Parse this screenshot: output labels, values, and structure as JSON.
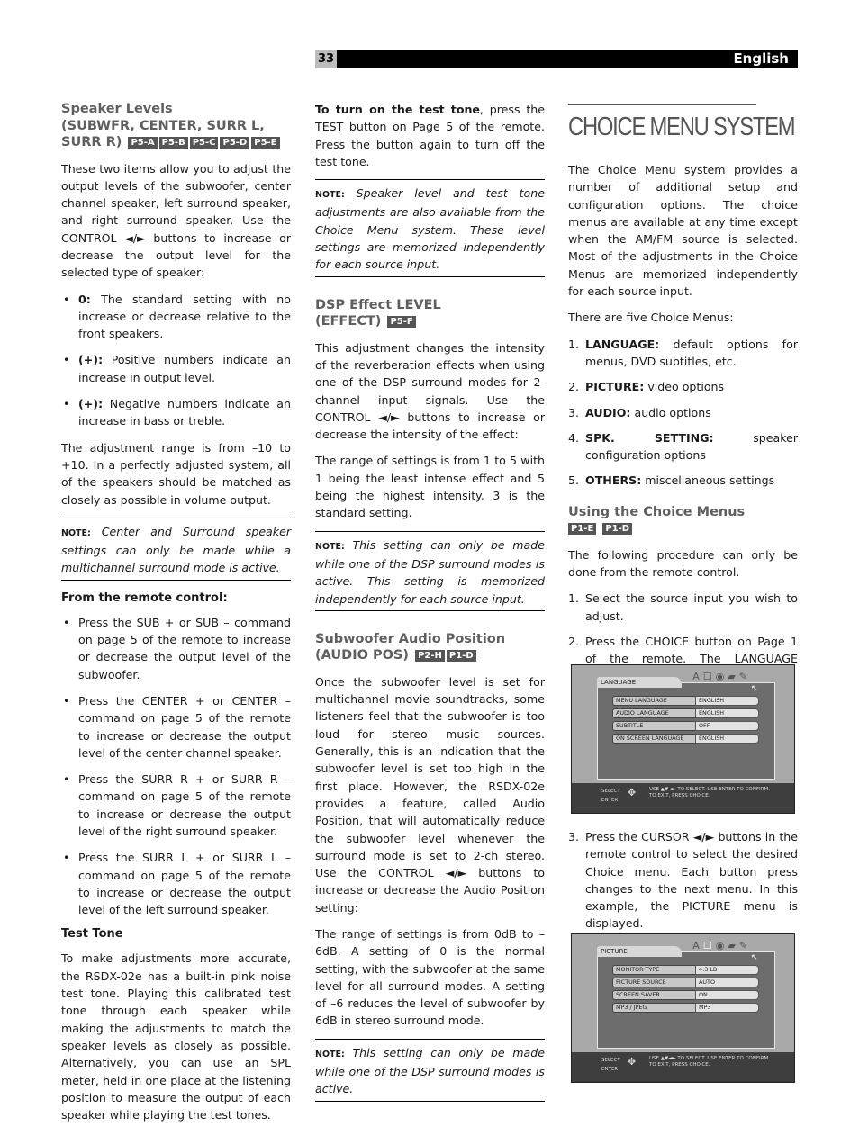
{
  "header": {
    "page_number": "33",
    "language": "English"
  },
  "col1": {
    "speaker_levels": {
      "title_lines": [
        "Speaker Levels",
        "(SUBWFR, CENTER, SURR L,",
        "SURR R)"
      ],
      "tags": [
        "P5-A",
        "P5-B",
        "P5-C",
        "P5-D",
        "P5-E"
      ],
      "intro": "These two items allow you to adjust the output levels of the subwoofer, center channel speaker, left surround speaker, and right surround speaker. Use the CONTROL ◄/► buttons to increase or decrease the output level for the selected type of speaker:",
      "bullets": [
        {
          "label": "0:",
          "text": " The standard setting with no increase or decrease relative to the front speakers."
        },
        {
          "label": "(+):",
          "text": " Positive numbers indicate an increase in output level."
        },
        {
          "label": "(+):",
          "text": " Negative numbers indicate an increase in bass or treble."
        }
      ],
      "range": "The adjustment range is from –10 to +10. In a perfectly adjusted system, all of the speakers should be matched as closely as possible in volume output.",
      "note_label": "NOTE:",
      "note": " Center and Surround speaker settings can only be made while a multichannel surround mode is active."
    },
    "remote": {
      "heading": "From the remote control:",
      "bullets": [
        "Press the SUB + or SUB – command on page 5 of the remote to increase or decrease the output level of the subwoofer.",
        "Press the CENTER + or CENTER – command on page 5 of the remote to increase or decrease the output level of the center channel speaker.",
        "Press the SURR R + or SURR R – command on page 5 of the remote to increase or decrease the output level of the right surround speaker.",
        "Press the SURR L + or SURR L – command on page 5 of the remote to increase or decrease the output level of the left surround speaker."
      ]
    },
    "test_tone": {
      "heading": "Test Tone",
      "text": "To make adjustments more accurate, the RSDX-02e has a built-in pink noise test tone. Playing this calibrated test tone through each speaker while making the adjustments to match the speaker levels as closely as possible. Alternatively, you can use an SPL meter, held in one place at the listening position to measure the output of each speaker while playing the test tones."
    }
  },
  "col2": {
    "turn_on": {
      "lead": "To turn on the test tone",
      "text": ", press the TEST button on Page 5 of the remote. Press the button again to turn off the test tone."
    },
    "note1": {
      "label": "NOTE:",
      "text": " Speaker level and test tone adjustments are also available from the Choice Menu system. These level settings are memorized independently for each source input."
    },
    "dsp": {
      "title_lines": [
        "DSP Effect LEVEL",
        "(EFFECT)"
      ],
      "tags": [
        "P5-F"
      ],
      "p1": "This adjustment changes the intensity of the reverberation effects when using one of the DSP surround modes for 2-channel input signals. Use the CONTROL ◄/► buttons to increase or decrease the intensity of the effect:",
      "p2": "The range of settings is from 1 to 5 with 1 being the least intense effect and 5 being the highest intensity. 3 is the standard setting.",
      "note_label": "NOTE:",
      "note": " This setting can only be made while one of the DSP surround modes is active. This setting is memorized independently for each source input."
    },
    "audio_pos": {
      "title_lines": [
        "Subwoofer Audio Position",
        "(AUDIO POS)"
      ],
      "tags": [
        "P2-H",
        "P1-D"
      ],
      "p1": "Once the subwoofer level is set for multichannel movie soundtracks, some listeners feel that the subwoofer is too loud for stereo music sources. Generally, this is an indication that the subwoofer level is set too high in the first place. However, the RSDX-02e provides a feature, called Audio Position, that will automatically reduce the subwoofer level whenever the surround mode is set to 2-ch stereo. Use the CONTROL ◄/► buttons to increase or decrease the Audio Position setting:",
      "p2": "The range of settings is from 0dB to –6dB. A setting of 0 is the normal setting, with the subwoofer at the same level for all surround modes. A setting of –6 reduces the level of subwoofer by 6dB in stereo surround mode.",
      "note_label": "NOTE:",
      "note": " This setting can only be made while one of the DSP surround modes is active."
    }
  },
  "col3": {
    "title": "CHOICE MENU SYSTEM",
    "intro": "The Choice Menu system provides a number of additional setup and configuration options. The choice menus are available at any time except when the AM/FM source is selected. Most of the adjustments in the Choice Menus are memorized independently for each source input.",
    "five": "There are five Choice Menus:",
    "menus": [
      {
        "n": "1.",
        "label": "LANGUAGE:",
        "text": " default options for menus, DVD subtitles, etc."
      },
      {
        "n": "2.",
        "label": "PICTURE:",
        "text": " video options"
      },
      {
        "n": "3.",
        "label": "AUDIO:",
        "text": " audio options"
      },
      {
        "n": "4.",
        "label": "SPK. SETTING:",
        "text": " speaker configuration options"
      },
      {
        "n": "5.",
        "label": "OTHERS:",
        "text": " miscellaneous settings"
      }
    ],
    "using": {
      "title": "Using the Choice Menus",
      "tags": [
        "P1-E",
        "P1-D"
      ],
      "intro": "The following procedure can only be done from the remote control.",
      "steps": [
        {
          "n": "1.",
          "text": "Select the source input you wish to adjust."
        },
        {
          "n": "2.",
          "text": "Press the CHOICE button on Page 1 of the remote. The LANGUAGE Choice Menu appears on the TV."
        },
        {
          "n": "3.",
          "text": "Press the CURSOR ◄/► buttons in the remote control to select the desired Choice menu. Each button press changes to the next menu. In this example, the PICTURE menu is displayed."
        }
      ]
    },
    "screens": [
      {
        "tab": "LANGUAGE",
        "rows": [
          {
            "key": "MENU LANGUAGE",
            "value": "ENGLISH"
          },
          {
            "key": "AUDIO LANGUAGE",
            "value": "ENGLISH"
          },
          {
            "key": "SUBTITLE",
            "value": "OFF"
          },
          {
            "key": "ON SCREEN LANGUAGE",
            "value": "ENGLISH"
          }
        ],
        "footer_left": [
          "SELECT",
          "ENTER"
        ],
        "footer_text": [
          "USE ▲▼◄► TO SELECT. USE ENTER TO CONFIRM.",
          "TO EXIT, PRESS CHOICE."
        ]
      },
      {
        "tab": "PICTURE",
        "rows": [
          {
            "key": "MONITOR TYPE",
            "value": "4:3 LB"
          },
          {
            "key": "PICTURE SOURCE",
            "value": "AUTO"
          },
          {
            "key": "SCREEN SAVER",
            "value": "ON"
          },
          {
            "key": "MP3 / JPEG",
            "value": "MP3"
          }
        ],
        "footer_left": [
          "SELECT",
          "ENTER"
        ],
        "footer_text": [
          "USE ▲▼◄► TO SELECT. USE ENTER TO CONFIRM.",
          "TO EXIT, PRESS CHOICE."
        ]
      }
    ],
    "screen_icons": [
      "A",
      "☐",
      "◉",
      "▰",
      "✎"
    ]
  }
}
